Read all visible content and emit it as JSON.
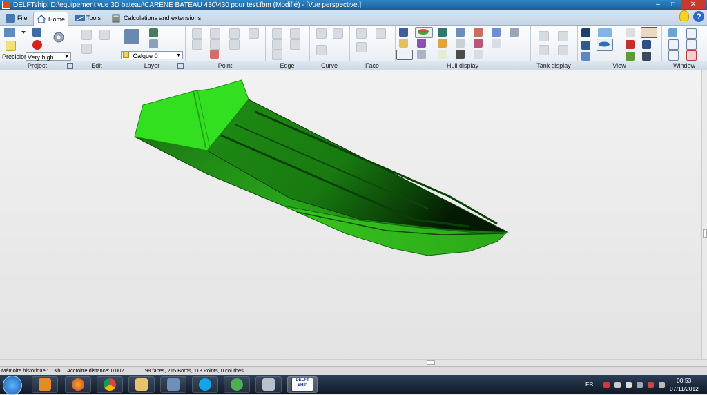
{
  "window": {
    "title": "DELFTship: D:\\equipement vue 3D bateau\\CARENE BATEAU 430\\430 pour test.fbm (Modifié) - [Vue  perspective.]",
    "controls": {
      "minimize": "–",
      "maximize": "□",
      "close": "✕"
    }
  },
  "tabs": [
    {
      "label": "File"
    },
    {
      "label": "Home"
    },
    {
      "label": "Tools"
    },
    {
      "label": "Calculations and extensions"
    }
  ],
  "help_label": "?",
  "ribbon": {
    "groups": {
      "project": "Project",
      "edit": "Edit",
      "layer": "Layer",
      "point": "Point",
      "edge": "Edge",
      "curve": "Curve",
      "face": "Face",
      "hull_display": "Hull display",
      "tank_display": "Tank display",
      "view": "View",
      "window": "Window"
    },
    "precision_label": "Precision",
    "precision_value": "Very high",
    "layer_value": "Calque 0"
  },
  "status": {
    "memory": "Mémoire historique : 0 Kb.",
    "snap": "Accroitre distance: 0.002",
    "counts": "98 faces, 215 Bords, 118 Points, 0 courbes"
  },
  "taskbar": {
    "delft_label": "DELFT SHIP",
    "language": "FR",
    "time": "00:53",
    "date": "07/11/2012"
  },
  "colors": {
    "hull_green": "#39d01d",
    "hull_dark": "#0a3a08",
    "titlebar": "#1d5f98"
  }
}
